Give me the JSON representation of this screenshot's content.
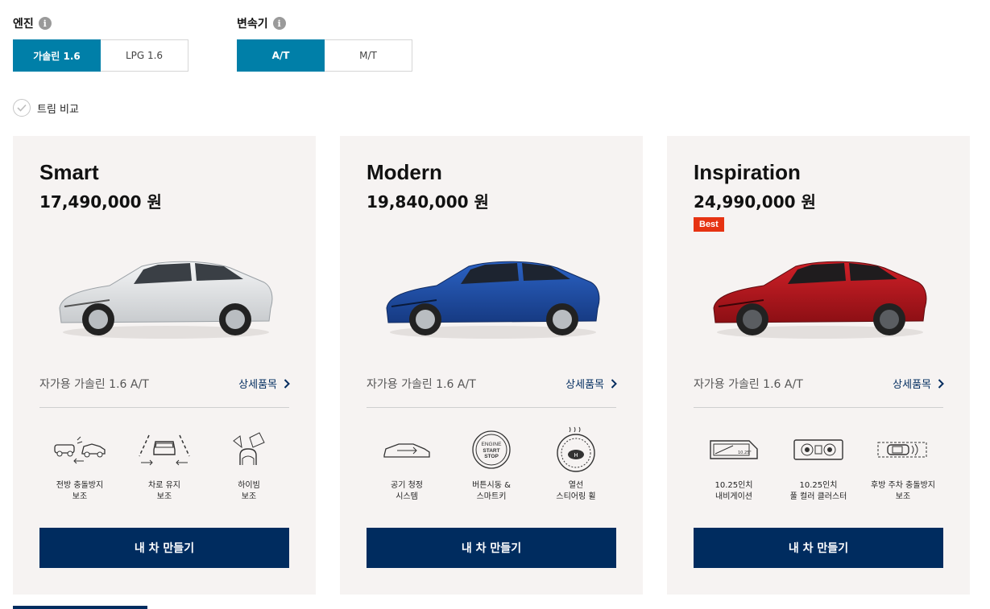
{
  "engine": {
    "title": "엔진",
    "options": [
      "가솔린 1.6",
      "LPG 1.6"
    ],
    "selected": 0
  },
  "transmission": {
    "title": "변속기",
    "options": [
      "A/T",
      "M/T"
    ],
    "selected": 0
  },
  "compare_label": "트림 비교",
  "info_icon_glyph": "i",
  "cards": [
    {
      "name": "Smart",
      "price": "17,490,000 원",
      "badge": "",
      "color": "silver",
      "spec": "자가용 가솔린 1.6 A/T",
      "detail_label": "상세품목",
      "features": [
        {
          "icon": "forward-collision-icon",
          "label": "전방 충돌방지\n보조"
        },
        {
          "icon": "lane-keep-icon",
          "label": "차로 유지\n보조"
        },
        {
          "icon": "high-beam-icon",
          "label": "하이빔\n보조"
        }
      ],
      "build_label": "내 차 만들기"
    },
    {
      "name": "Modern",
      "price": "19,840,000 원",
      "badge": "",
      "color": "blue",
      "spec": "자가용 가솔린 1.6 A/T",
      "detail_label": "상세품목",
      "features": [
        {
          "icon": "air-purifier-icon",
          "label": "공기 청정\n시스템"
        },
        {
          "icon": "engine-start-icon",
          "label": "버튼시동 &\n스마트키"
        },
        {
          "icon": "heated-wheel-icon",
          "label": "열선\n스티어링 휠"
        }
      ],
      "build_label": "내 차 만들기"
    },
    {
      "name": "Inspiration",
      "price": "24,990,000 원",
      "badge": "Best",
      "color": "red",
      "spec": "자가용 가솔린 1.6 A/T",
      "detail_label": "상세품목",
      "features": [
        {
          "icon": "navigation-icon",
          "label": "10.25인치\n내비게이션"
        },
        {
          "icon": "cluster-icon",
          "label": "10.25인치\n풀 컬러 클러스터"
        },
        {
          "icon": "rear-parking-icon",
          "label": "후방 주차 충돌방지\n보조"
        }
      ],
      "build_label": "내 차 만들기"
    }
  ],
  "icon_text": {
    "engine_start": [
      "ENGINE",
      "START",
      "STOP"
    ],
    "navigation_screen": "10.25\""
  },
  "colors": {
    "accent": "#007fa8",
    "navy": "#002c5f",
    "badge": "#e63312",
    "card_bg": "#f6f3f2",
    "car_silver": "#dfe1e3",
    "car_blue": "#1f4fa8",
    "car_red": "#b3141c"
  }
}
